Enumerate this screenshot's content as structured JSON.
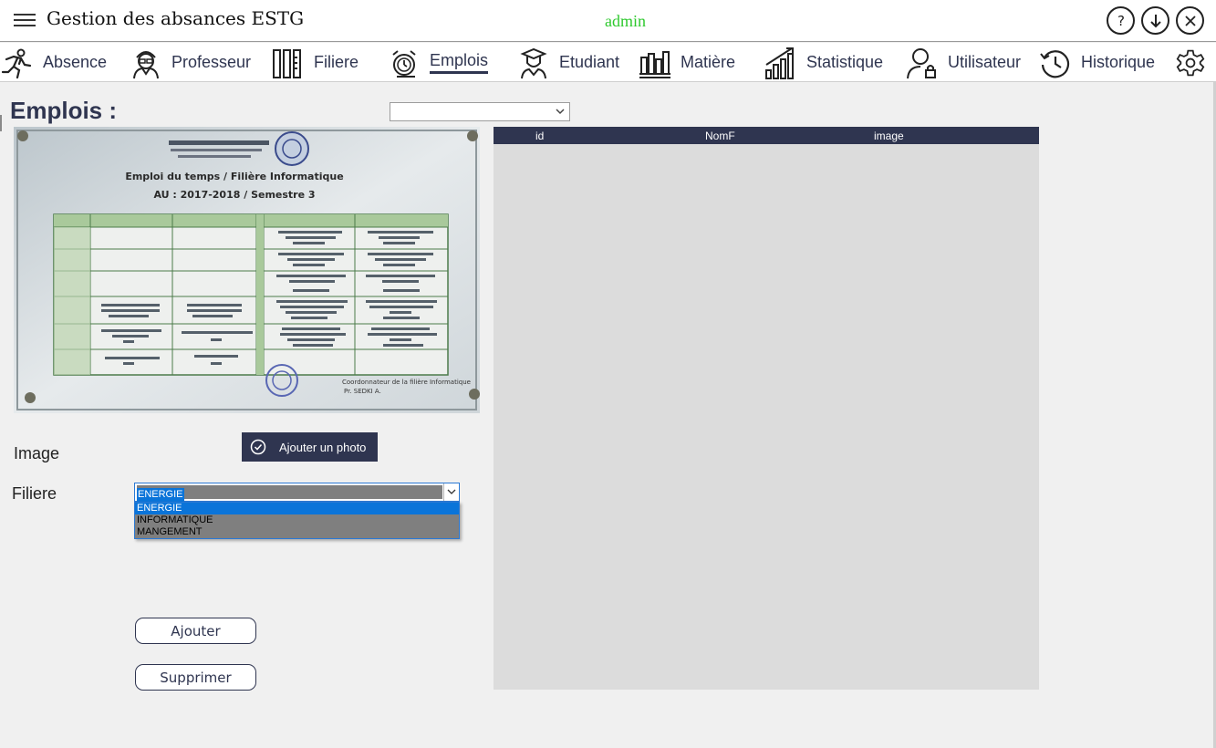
{
  "app": {
    "title": "Gestion des absances ESTG",
    "user": "admin"
  },
  "window_controls": {
    "help_icon": "question-circle-icon",
    "minimize_icon": "arrow-down-circle-icon",
    "close_icon": "close-circle-icon"
  },
  "nav": {
    "items": [
      {
        "label": "Absence",
        "icon": "running-person-icon"
      },
      {
        "label": "Professeur",
        "icon": "teacher-icon"
      },
      {
        "label": "Filiere",
        "icon": "tools-icon"
      },
      {
        "label": "Emplois",
        "icon": "alarm-clock-icon",
        "active": true
      },
      {
        "label": "Etudiant",
        "icon": "student-icon"
      },
      {
        "label": "Matière",
        "icon": "books-icon"
      },
      {
        "label": "Statistique",
        "icon": "chart-growth-icon"
      },
      {
        "label": "Utilisateur",
        "icon": "user-lock-icon"
      },
      {
        "label": "Historique",
        "icon": "history-clock-icon"
      }
    ],
    "settings_icon": "gear-icon"
  },
  "page": {
    "title": "Emplois :",
    "top_select_value": ""
  },
  "form": {
    "image_label": "Image",
    "photo_button": "Ajouter un photo",
    "filiere_label": "Filiere",
    "filiere_selected": "ENERGIE",
    "filiere_options": [
      "ENERGIE",
      "INFORMATIQUE",
      "MANGEMENT"
    ],
    "add_button": "Ajouter",
    "delete_button": "Supprimer"
  },
  "photo": {
    "heading": "Emploi du temps / Filière Informatique",
    "subheading": "AU : 2017-2018 / Semestre 3",
    "footer_line1": "Coordonnateur de la filière Informatique",
    "footer_line2": "Pr. SEDKI A."
  },
  "grid": {
    "columns": [
      "id",
      "NomF",
      "image"
    ],
    "rows": []
  },
  "colors": {
    "primary": "#2f3550",
    "user_label": "#2ec92e",
    "selection": "#0a74d9",
    "grid_bg": "#dcdcdc"
  }
}
